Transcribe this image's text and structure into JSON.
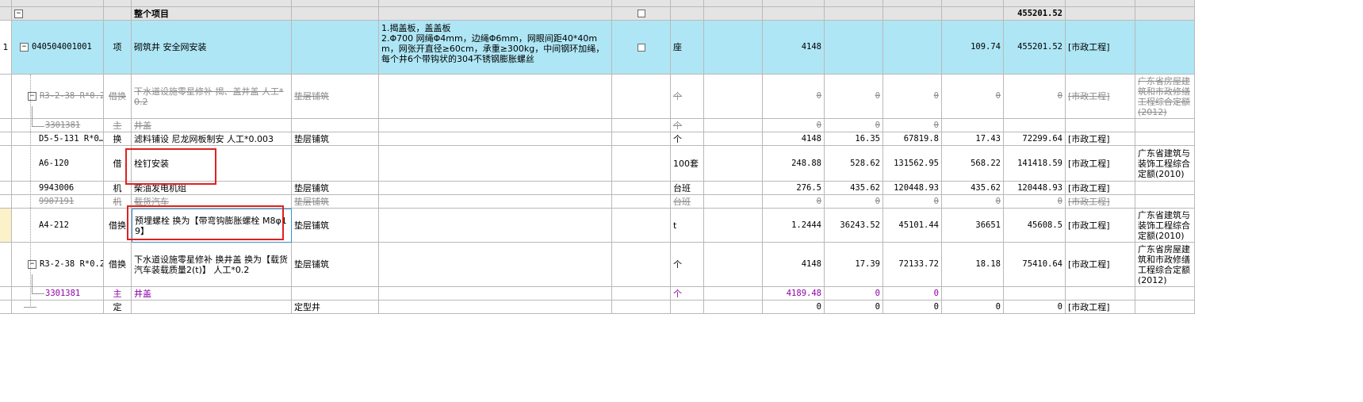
{
  "colors": {
    "row_selected": "#aee6f5",
    "header_bg": "#e4e4e4",
    "highlight": "#e02020",
    "purple": "#8e00a8"
  },
  "total": {
    "toggle": "−",
    "name": "整个项目",
    "total_price": "455201.52"
  },
  "main": {
    "seq": "1",
    "code": "040504001001",
    "category": "项",
    "name": "砌筑井 安全网安装",
    "features": "1.揭盖板，盖盖板\n2.Φ700 网绳Φ4mm，边绳Φ6mm，网眼间距40*40mm，网张开直径≥60cm，承重≥300kg，中间钢环加绳，每个井6个带钩状的304不锈钢膨胀螺丝",
    "unit": "座",
    "quantity": "4148",
    "unit_price": "109.74",
    "total_price": "455201.52",
    "discipline": "[市政工程]"
  },
  "rows": [
    {
      "code": "R3-2-38 R*0.2",
      "category": "借换",
      "name": "下水道设施零星修补 揭、盖井盖  人工*0.2",
      "work": "垫层铺筑",
      "unit": "个",
      "quantity": "0",
      "price": "0",
      "total": "0",
      "unit_price": "0",
      "total_price": "0",
      "discipline": "[市政工程]",
      "norm": "广东省房屋建筑和市政修缮工程综合定额(2012)"
    },
    {
      "code": "3301381",
      "category": "主",
      "name": "井盖",
      "unit": "个",
      "quantity": "0",
      "price": "0",
      "total": "0"
    },
    {
      "code": "D5-5-131 R*0…",
      "category": "换",
      "name": "滤料铺设 尼龙网板制安  人工*0.003",
      "work": "垫层铺筑",
      "unit": "个",
      "quantity": "4148",
      "price": "16.35",
      "total": "67819.8",
      "unit_price": "17.43",
      "total_price": "72299.64",
      "discipline": "[市政工程]"
    },
    {
      "code": "A6-120",
      "category": "借",
      "name": "栓钉安装",
      "unit": "100套",
      "quantity": "248.88",
      "price": "528.62",
      "total": "131562.95",
      "unit_price": "568.22",
      "total_price": "141418.59",
      "discipline": "[市政工程]",
      "norm": "广东省建筑与装饰工程综合定额(2010)"
    },
    {
      "code": "9943006",
      "category": "机",
      "name": "柴油发电机组",
      "work": "垫层铺筑",
      "unit": "台班",
      "quantity": "276.5",
      "price": "435.62",
      "total": "120448.93",
      "unit_price": "435.62",
      "total_price": "120448.93",
      "discipline": "[市政工程]"
    },
    {
      "code": "9907191",
      "category": "机",
      "name": "载货汽车",
      "work": "垫层铺筑",
      "unit": "台班",
      "quantity": "0",
      "price": "0",
      "total": "0",
      "unit_price": "0",
      "total_price": "0",
      "discipline": "[市政工程]"
    },
    {
      "code": "A4-212",
      "category": "借换",
      "name": "预埋螺栓  换为【带弯钩膨胀螺栓 M8φ19】",
      "work": "垫层铺筑",
      "unit": "t",
      "quantity": "1.2444",
      "price": "36243.52",
      "total": "45101.44",
      "unit_price": "36651",
      "total_price": "45608.5",
      "discipline": "[市政工程]",
      "norm": "广东省建筑与装饰工程综合定额(2010)"
    },
    {
      "code": "R3-2-38 R*0.2",
      "category": "借换",
      "name": "下水道设施零星修补 换井盖  换为【载货汽车装载质量2(t)】  人工*0.2",
      "work": "垫层铺筑",
      "unit": "个",
      "quantity": "4148",
      "price": "17.39",
      "total": "72133.72",
      "unit_price": "18.18",
      "total_price": "75410.64",
      "discipline": "[市政工程]",
      "norm": "广东省房屋建筑和市政修缮工程综合定额(2012)"
    },
    {
      "code": "3301381",
      "category": "主",
      "name": "井盖",
      "unit": "个",
      "quantity": "4189.48",
      "price": "0",
      "total": "0"
    },
    {
      "category": "定",
      "work": "定型井",
      "quantity": "0",
      "price": "0",
      "total": "0",
      "unit_price": "0",
      "total_price": "0",
      "discipline": "[市政工程]"
    }
  ]
}
